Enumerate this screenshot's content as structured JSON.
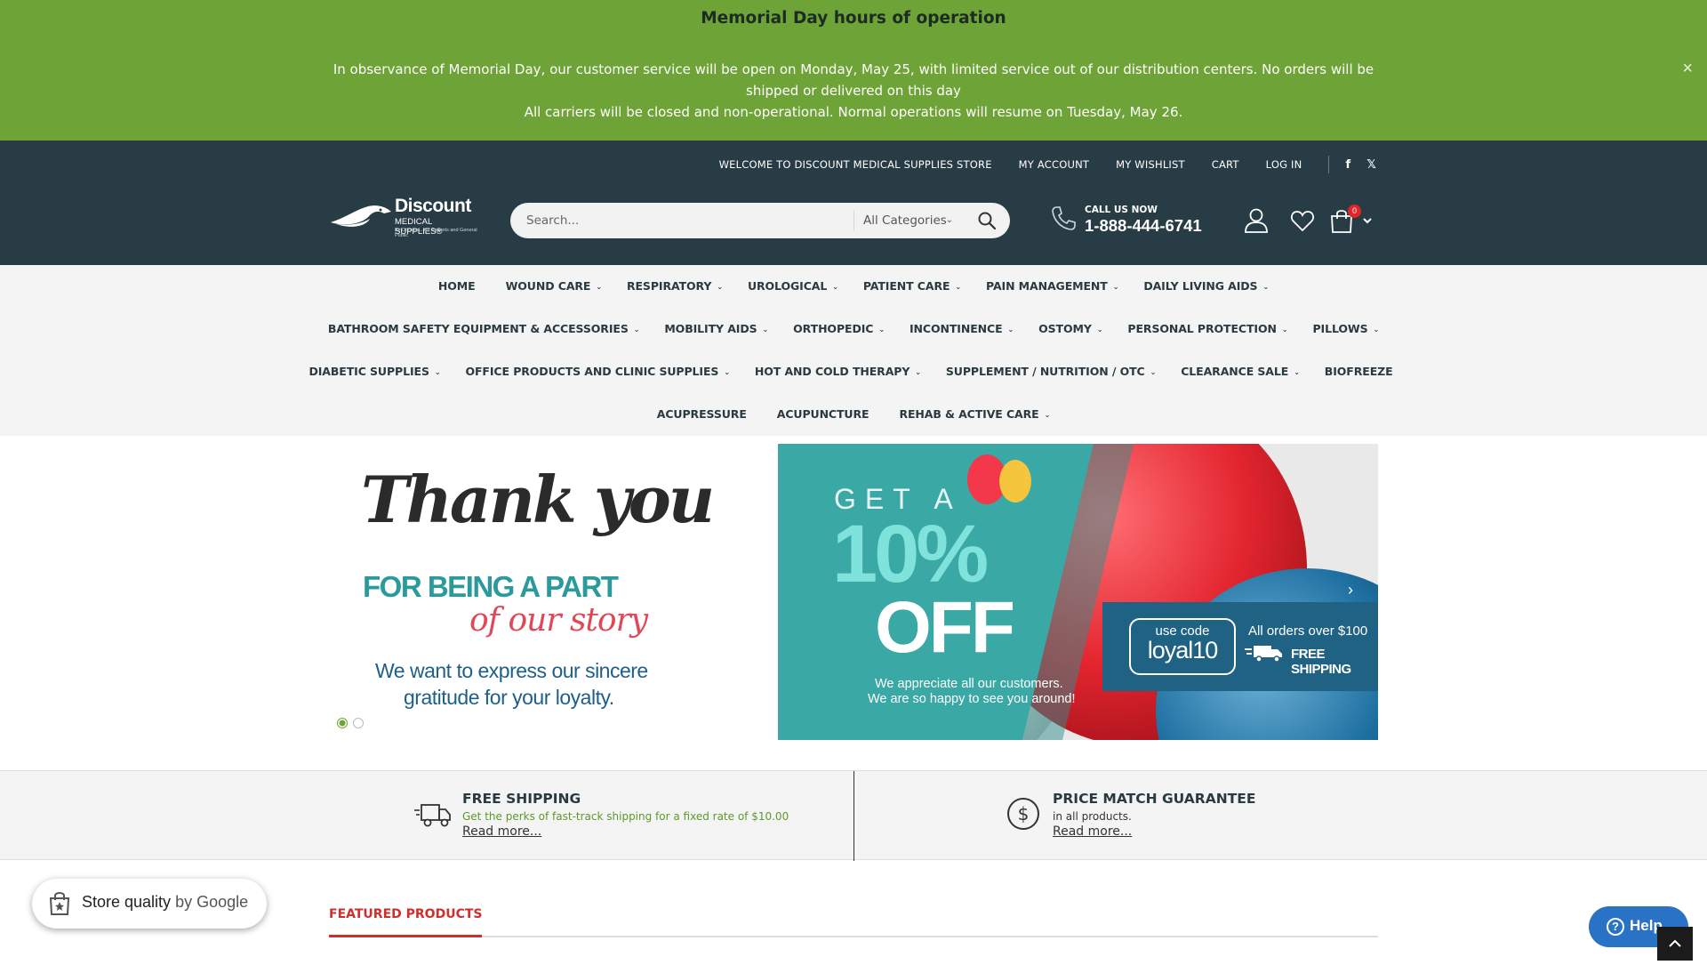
{
  "notice": {
    "title": "Memorial Day hours of operation",
    "line1": "In observance of Memorial Day, our customer service will be open on Monday, May 25, with limited service out of our distribution centers. No orders will be shipped or delivered on this day",
    "line2": "All carriers will be closed and non-operational. Normal operations will resume on Tuesday, May 26.",
    "close_label": "×",
    "bg_color": "#6da337"
  },
  "toplinks": {
    "welcome": "WELCOME TO DISCOUNT MEDICAL SUPPLIES STORE",
    "account": "MY ACCOUNT",
    "wishlist": "MY WISHLIST",
    "cart": "CART",
    "login": "LOG IN",
    "facebook": "f",
    "x": "𝕏"
  },
  "logo": {
    "name": "Discount",
    "sub": "MEDICAL SUPPLIES®",
    "tagline": "By Doctors... for Patients and General Public"
  },
  "search": {
    "placeholder": "Search...",
    "category": "All Categories",
    "icon": "search-icon"
  },
  "phone": {
    "label": "CALL US NOW",
    "number": "1-888-444-6741"
  },
  "cart": {
    "count": "0"
  },
  "nav": {
    "row1": [
      {
        "label": "HOME",
        "caret": ""
      },
      {
        "label": "WOUND CARE",
        "caret": "⌄"
      },
      {
        "label": "RESPIRATORY",
        "caret": "⌄"
      },
      {
        "label": "UROLOGICAL",
        "caret": "⌄"
      },
      {
        "label": "PATIENT CARE",
        "caret": "⌄"
      },
      {
        "label": "PAIN MANAGEMENT",
        "caret": "⌄"
      },
      {
        "label": "DAILY LIVING AIDS",
        "caret": "⌄"
      }
    ],
    "row2": [
      {
        "label": "BATHROOM SAFETY EQUIPMENT & ACCESSORIES",
        "caret": "⌄"
      },
      {
        "label": "MOBILITY AIDS",
        "caret": "⌄"
      },
      {
        "label": "ORTHOPEDIC",
        "caret": "⌄"
      },
      {
        "label": "INCONTINENCE",
        "caret": "⌄"
      },
      {
        "label": "OSTOMY",
        "caret": "⌄"
      },
      {
        "label": "PERSONAL PROTECTION",
        "caret": "⌄"
      },
      {
        "label": "PILLOWS",
        "caret": "⌄"
      }
    ],
    "row3": [
      {
        "label": "DIABETIC SUPPLIES",
        "caret": "⌄"
      },
      {
        "label": "OFFICE PRODUCTS AND CLINIC SUPPLIES",
        "caret": "⌄"
      },
      {
        "label": "HOT AND COLD THERAPY",
        "caret": "⌄"
      },
      {
        "label": "SUPPLEMENT / NUTRITION / OTC",
        "caret": "⌄"
      },
      {
        "label": "CLEARANCE SALE",
        "caret": "⌄"
      },
      {
        "label": "BIOFREEZE",
        "caret": ""
      }
    ],
    "row4": [
      {
        "label": "ACUPRESSURE",
        "caret": ""
      },
      {
        "label": "ACUPUNCTURE",
        "caret": ""
      },
      {
        "label": "REHAB & ACTIVE CARE",
        "caret": "⌄"
      }
    ]
  },
  "banner": {
    "thank": "Thank you",
    "part": "FOR BEING A PART",
    "story": "of our story",
    "gratitude1": "We want to express our sincere",
    "gratitude2": "gratitude for your loyalty.",
    "get_a": "GET A",
    "pct": "10%",
    "off": "OFF",
    "appreciate1": "We appreciate all our customers.",
    "appreciate2": "We are so happy to see you around!",
    "use_code": "use code",
    "code": "loyal10",
    "orders": "All orders over $100",
    "free_ship": "FREE SHIPPING",
    "next": "›",
    "slide_count": 2,
    "active_slide": 1
  },
  "features": [
    {
      "title": "FREE SHIPPING",
      "desc": "Get the perks of fast-track shipping for a fixed rate of $10.00",
      "desc_color": "#5a9a2a",
      "more": "Read more..."
    },
    {
      "title": "PRICE MATCH GUARANTEE",
      "desc": "in all products.",
      "desc_color": "#333333",
      "more": "Read more..."
    }
  ],
  "featured": {
    "tab": "FEATURED PRODUCTS"
  },
  "store_quality": {
    "main": "Store quality",
    "by": " by Google"
  },
  "help": {
    "label": "Help",
    "q": "?"
  }
}
